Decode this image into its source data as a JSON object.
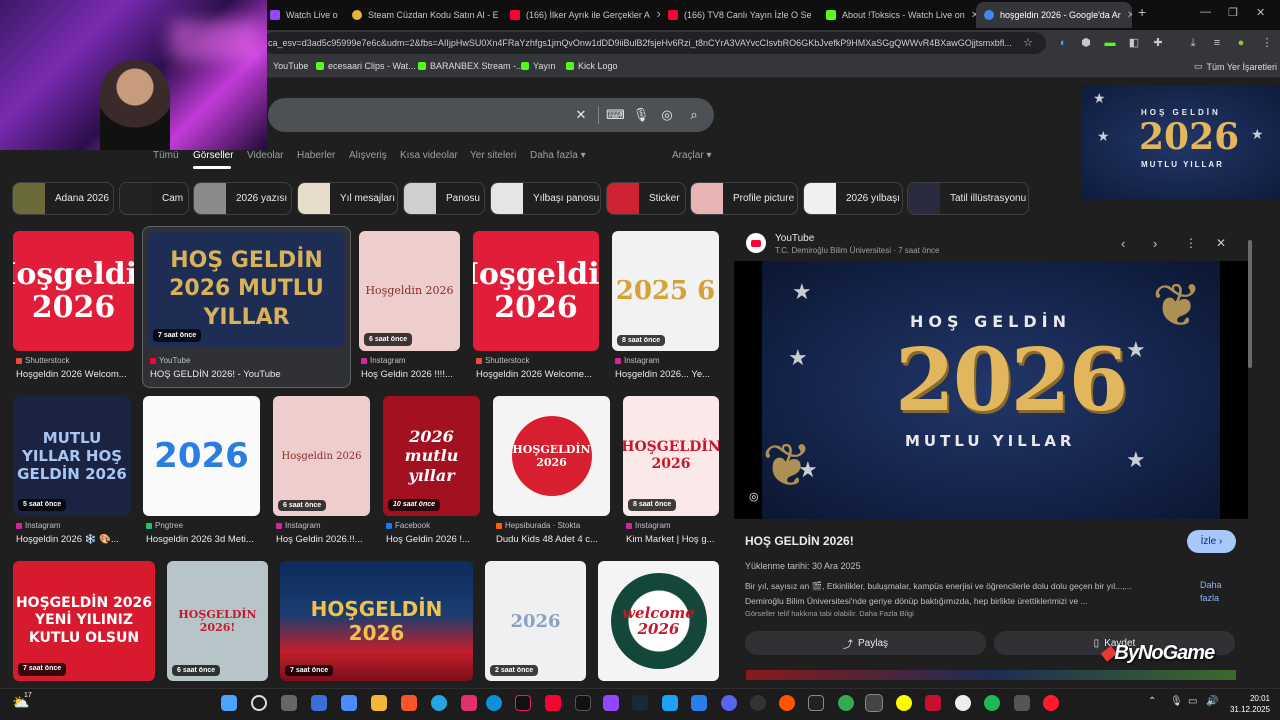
{
  "browser": {
    "tabs": [
      {
        "label": "Watch Live o",
        "fav": "#9146ff"
      },
      {
        "label": "Steam Cüzdan Kodu Satın Al - E",
        "fav": "#e0b53a"
      },
      {
        "label": "(166) İlker Ayrık ile Gerçekler A",
        "fav": "#ff0033"
      },
      {
        "label": "(166) TV8 Canlı Yayın İzle O Se",
        "fav": "#ff0033"
      },
      {
        "label": "About !Toksics - Watch Live on",
        "fav": "#53fc18"
      },
      {
        "label": "hoşgeldin 2026 - Google'da Ar",
        "fav": "#4285f4"
      }
    ],
    "url": "ca_esv=d3ad5c95999e7e6c&udm=2&fbs=AIIjpHwSU0Xn4FRaYzhfgs1jmQvOnw1dDD9iiBulB2fsjeHv6Rzi_t8nCYrA3VAYvcCIsvbRO6GKbJvefkP9HMXaSGgQWWvR4BXawGOjjtsmxbfl...",
    "bookmarks": [
      {
        "label": "YouTube",
        "fav": "#ff0033"
      },
      {
        "label": "ecesaari Clips - Wat...",
        "fav": "#53fc18"
      },
      {
        "label": "BARANBEX Stream -...",
        "fav": "#53fc18"
      },
      {
        "label": "Yayın",
        "fav": "#53fc18"
      },
      {
        "label": "Kick Logo",
        "fav": "#53fc18"
      }
    ],
    "all_bookmarks": "Tüm Yer İşaretleri"
  },
  "search": {
    "tabs": [
      "Tümü",
      "Görseller",
      "Videolar",
      "Haberler",
      "Alışveriş",
      "Kısa videolar",
      "Yer siteleri",
      "Daha fazla ▾"
    ],
    "tools": "Araçlar ▾"
  },
  "chips": [
    {
      "label": "Adana 2026",
      "color": "#6b6b3a"
    },
    {
      "label": "Cam",
      "color": "#222"
    },
    {
      "label": "2026 yazısı",
      "color": "#8a8a8a"
    },
    {
      "label": "Yıl mesajları",
      "color": "#e8dccb"
    },
    {
      "label": "Panosu",
      "color": "#cfcfcf"
    },
    {
      "label": "Yılbaşı panosu",
      "color": "#e5e5e5"
    },
    {
      "label": "Sticker",
      "color": "#cf2232"
    },
    {
      "label": "Profile picture",
      "color": "#e7b3b3"
    },
    {
      "label": "2026 yılbaşı",
      "color": "#f0f0f0"
    },
    {
      "label": "Tatil illüstrasyonu",
      "color": "#2b2b40"
    }
  ],
  "results": [
    {
      "img": "Hoşgeldin 2026",
      "age": "",
      "source": "Shutterstock",
      "title": "Hoşgeldin 2026 Welcom...",
      "src_color": "#ee4c36"
    },
    {
      "img": "HOŞ GELDİN 2026 MUTLU YILLAR",
      "age": "7 saat önce",
      "source": "YouTube",
      "title": "HOŞ GELDİN 2026! - YouTube",
      "src_color": "#ff0033"
    },
    {
      "img": "Hoşgeldin 2026",
      "age": "6 saat önce",
      "source": "Instagram",
      "title": "Hoş Geldin 2026 !!!!...",
      "src_color": "#d6249f"
    },
    {
      "img": "Hoşgeldin 2026",
      "age": "",
      "source": "Shutterstock",
      "title": "Hoşgeldin 2026 Welcome...",
      "src_color": "#ee4c36"
    },
    {
      "img": "2025 6",
      "age": "8 saat önce",
      "source": "Instagram",
      "title": "Hoşgeldin 2026... Ye...",
      "src_color": "#d6249f"
    },
    {
      "img": "MUTLU YILLAR HOŞ GELDİN 2026",
      "age": "5 saat önce",
      "source": "Instagram",
      "title": "Hoşgeldin 2026 ❄️ 🎨...",
      "src_color": "#d6249f"
    },
    {
      "img": "2026",
      "age": "",
      "source": "Pngtree",
      "title": "Hosgeldin 2026 3d Meti...",
      "src_color": "#23c16b"
    },
    {
      "img": "Hoşgeldin 2026",
      "age": "6 saat önce",
      "source": "Instagram",
      "title": "Hoş Geldin 2026.!!...",
      "src_color": "#d6249f"
    },
    {
      "img": "2026 mutlu yıllar",
      "age": "10 saat önce",
      "source": "Facebook",
      "title": "Hoş Geldin 2026 !...",
      "src_color": "#1877f2"
    },
    {
      "img": "HOŞGELDİN 2026",
      "age": "",
      "source": "Hepsiburada · Stokta",
      "title": "Dudu Kids 48 Adet 4 c...",
      "src_color": "#ff6000"
    },
    {
      "img": "HOŞGELDİN 2026",
      "age": "8 saat önce",
      "source": "Instagram",
      "title": "Kim Market | Hoş g...",
      "src_color": "#d6249f"
    },
    {
      "img": "HOŞGELDİN 2026 YENİ YILINIZ KUTLU OLSUN",
      "age": "7 saat önce",
      "source": "",
      "title": "",
      "src_color": ""
    },
    {
      "img": "HOŞGELDİN 2026!",
      "age": "6 saat önce",
      "source": "",
      "title": "",
      "src_color": ""
    },
    {
      "img": "HOŞGELDİN 2026",
      "age": "7 saat önce",
      "source": "",
      "title": "",
      "src_color": ""
    },
    {
      "img": "2026",
      "age": "2 saat önce",
      "source": "",
      "title": "",
      "src_color": ""
    },
    {
      "img": "welcome 2026",
      "age": "",
      "source": "",
      "title": "",
      "src_color": ""
    }
  ],
  "preview": {
    "site": "YouTube",
    "channel": "T.C. Demiroğlu Bilim Üniversitesi · 7 saat önce",
    "image_top": "HOŞ GELDİN",
    "image_year": "2026",
    "image_bottom": "MUTLU YILLAR",
    "title": "HOŞ GELDİN 2026!",
    "watch": "İzle ›",
    "upload_date": "Yüklenme tarihi: 30 Ara 2025",
    "description_1": "Bir yıl, sayısız an 🎬, Etkinlikler, buluşmalar, kampüs enerjisi ve öğrencilerle dolu dolu geçen bir yıl...,...",
    "description_2": "Demiroğlu Bilim Üniversitesi'nde geriye dönüp baktığımızda, hep birlikte ürettiklerimizi ve ...",
    "more": "Daha fazla",
    "copyright": "Görseller telif hakkına tabi olabilir. Daha Fazla Bilgi",
    "share": "Paylaş",
    "save": "Kaydet"
  },
  "overlay": {
    "watermark": "ByNoGame",
    "float_top": "HOŞ GELDİN",
    "float_year": "2026",
    "float_bottom": "MUTLU YILLAR"
  },
  "taskbar": {
    "time": "20:01",
    "date": "31.12.2025",
    "weather": "17"
  }
}
